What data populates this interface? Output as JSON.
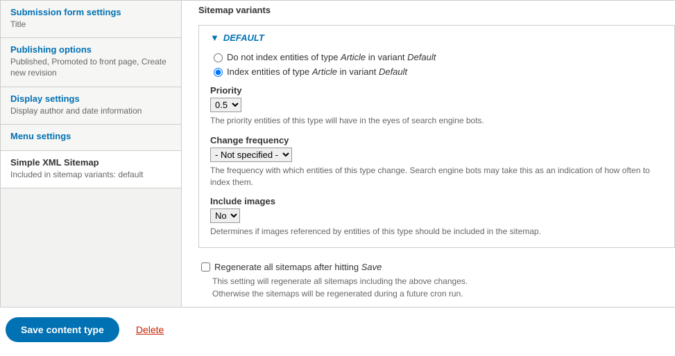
{
  "sidebar": {
    "tabs": [
      {
        "title": "Submission form settings",
        "desc": "Title"
      },
      {
        "title": "Publishing options",
        "desc": "Published, Promoted to front page, Create new revision"
      },
      {
        "title": "Display settings",
        "desc": "Display author and date information"
      },
      {
        "title": "Menu settings",
        "desc": ""
      },
      {
        "title": "Simple XML Sitemap",
        "desc": "Included in sitemap variants: default"
      }
    ]
  },
  "main": {
    "section_title": "Sitemap variants",
    "details_summary": "DEFAULT",
    "arrow": "▼",
    "radio": {
      "opt0_pre": "Do not index entities of type ",
      "opt0_entity": "Article",
      "opt0_mid": " in variant ",
      "opt0_variant": "Default",
      "opt1_pre": "Index entities of type ",
      "opt1_entity": "Article",
      "opt1_mid": " in variant ",
      "opt1_variant": "Default"
    },
    "priority": {
      "label": "Priority",
      "value": "0.5",
      "help": "The priority entities of this type will have in the eyes of search engine bots."
    },
    "changefreq": {
      "label": "Change frequency",
      "value": "- Not specified -",
      "help": "The frequency with which entities of this type change. Search engine bots may take this as an indication of how often to index them."
    },
    "images": {
      "label": "Include images",
      "value": "No",
      "help": "Determines if images referenced by entities of this type should be included in the sitemap."
    },
    "regen": {
      "label_pre": "Regenerate all sitemaps after hitting ",
      "label_em": "Save",
      "help1": "This setting will regenerate all sitemaps including the above changes.",
      "help2": "Otherwise the sitemaps will be regenerated during a future cron run."
    }
  },
  "actions": {
    "save": "Save content type",
    "delete": "Delete"
  }
}
